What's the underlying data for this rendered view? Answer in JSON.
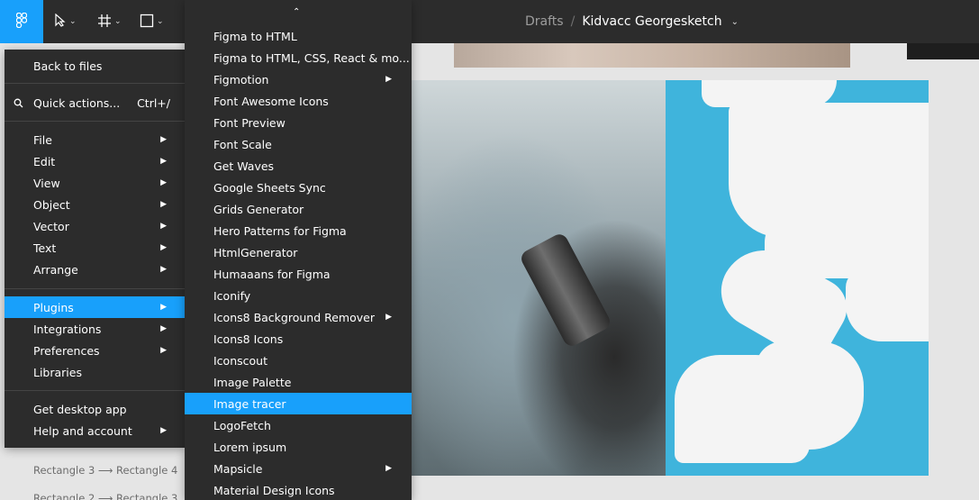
{
  "toolbar": {
    "tools": [
      {
        "name": "move-tool",
        "icon": "cursor-icon"
      },
      {
        "name": "frame-tool",
        "icon": "frame-icon"
      },
      {
        "name": "shape-tool",
        "icon": "rectangle-icon"
      }
    ]
  },
  "title": {
    "breadcrumb": "Drafts",
    "separator": "/",
    "file_name": "Kidvacc Georgesketch"
  },
  "main_menu": {
    "items": [
      {
        "label": "Back to files",
        "submenu": false
      },
      {
        "label": "Quick actions...",
        "shortcut": "Ctrl+/",
        "icon": "search-icon"
      },
      {
        "label": "File",
        "submenu": true
      },
      {
        "label": "Edit",
        "submenu": true
      },
      {
        "label": "View",
        "submenu": true
      },
      {
        "label": "Object",
        "submenu": true
      },
      {
        "label": "Vector",
        "submenu": true
      },
      {
        "label": "Text",
        "submenu": true
      },
      {
        "label": "Arrange",
        "submenu": true
      },
      {
        "label": "Plugins",
        "submenu": true,
        "active": true
      },
      {
        "label": "Integrations",
        "submenu": true
      },
      {
        "label": "Preferences",
        "submenu": true
      },
      {
        "label": "Libraries",
        "submenu": false
      },
      {
        "label": "Get desktop app",
        "submenu": false
      },
      {
        "label": "Help and account",
        "submenu": true
      }
    ]
  },
  "layers": [
    "Rectangle 3 ⟶ Rectangle 4",
    "Rectangle 2 ⟶ Rectangle 3"
  ],
  "plugins_menu": {
    "items": [
      {
        "label": "Figma to HTML",
        "submenu": false
      },
      {
        "label": "Figma to HTML, CSS, React & mo...",
        "submenu": false
      },
      {
        "label": "Figmotion",
        "submenu": true
      },
      {
        "label": "Font Awesome Icons",
        "submenu": false
      },
      {
        "label": "Font Preview",
        "submenu": false
      },
      {
        "label": "Font Scale",
        "submenu": false
      },
      {
        "label": "Get Waves",
        "submenu": false
      },
      {
        "label": "Google Sheets Sync",
        "submenu": false
      },
      {
        "label": "Grids Generator",
        "submenu": false
      },
      {
        "label": "Hero Patterns for Figma",
        "submenu": false
      },
      {
        "label": "HtmlGenerator",
        "submenu": false
      },
      {
        "label": "Humaaans for Figma",
        "submenu": false
      },
      {
        "label": "Iconify",
        "submenu": false
      },
      {
        "label": "Icons8 Background Remover",
        "submenu": true
      },
      {
        "label": "Icons8 Icons",
        "submenu": false
      },
      {
        "label": "Iconscout",
        "submenu": false
      },
      {
        "label": "Image Palette",
        "submenu": false
      },
      {
        "label": "Image tracer",
        "submenu": false,
        "active": true
      },
      {
        "label": "LogoFetch",
        "submenu": false
      },
      {
        "label": "Lorem ipsum",
        "submenu": false
      },
      {
        "label": "Mapsicle",
        "submenu": true
      },
      {
        "label": "Material Design Icons",
        "submenu": false
      }
    ]
  },
  "colors": {
    "accent": "#18a0fb",
    "menu_bg": "#2c2c2c",
    "trace_blue": "#3fb4dc"
  }
}
